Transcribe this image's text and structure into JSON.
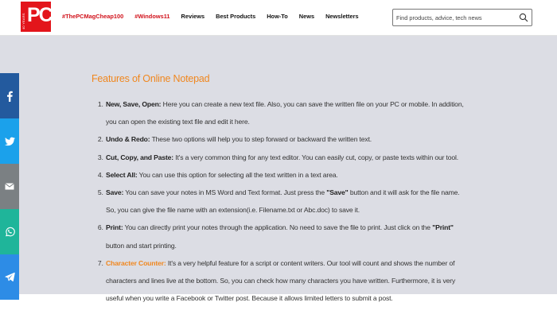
{
  "header": {
    "logo": {
      "years_text": "40 YEARS",
      "brand": "PC"
    },
    "nav": [
      {
        "label": "#ThePCMagCheap100",
        "tag": true
      },
      {
        "label": "#Windows11",
        "tag": true
      },
      {
        "label": "Reviews",
        "tag": false
      },
      {
        "label": "Best Products",
        "tag": false
      },
      {
        "label": "How-To",
        "tag": false
      },
      {
        "label": "News",
        "tag": false
      },
      {
        "label": "Newsletters",
        "tag": false
      }
    ],
    "search": {
      "placeholder": "Find products, advice, tech news",
      "icon": "search-icon"
    }
  },
  "article": {
    "heading": "Features of Online Notepad",
    "items": [
      {
        "title": "New, Save, Open:",
        "text": " Here you can create a new text file. Also, you can save the written file on your PC or mobile. In addition, you can open the existing text file and edit it here."
      },
      {
        "title": "Undo & Redo:",
        "text": " These two options will help you to step forward or backward the written text."
      },
      {
        "title": "Cut, Copy, and Paste:",
        "text": " It's a very common thing for any text editor. You can easily cut, copy, or paste texts within our tool."
      },
      {
        "title": "Select All:",
        "text": " You can use this option for selecting all the text written in a text area."
      },
      {
        "title": "Save:",
        "p1": " You can save your notes in MS Word and Text format. Just press the ",
        "q1": "\"Save\"",
        "p2": " button and it will ask for the file name. So, you can give the file name with an extension(i.e. Filename.txt or Abc.doc) to save it."
      },
      {
        "title": "Print:",
        "p1": " You can directly print your notes through the application. No need to save the file to print. Just click on the ",
        "q1": "\"Print\"",
        "p2": " button and start printing."
      },
      {
        "title": "Character Counter:",
        "text": " It's a very helpful feature for a script or content writers. Our tool will count and shows the number of characters and lines live at the bottom. So, you can check how many characters you have written. Furthermore, it is very useful when you write a Facebook or Twitter post. Because it allows limited letters to submit a post."
      }
    ]
  },
  "share": [
    {
      "icon": "facebook-icon",
      "color": "#235a9e"
    },
    {
      "icon": "twitter-icon",
      "color": "#1ba1eb"
    },
    {
      "icon": "email-icon",
      "color": "#7b8083"
    },
    {
      "icon": "whatsapp-icon",
      "color": "#1fb59a"
    },
    {
      "icon": "telegram-icon",
      "color": "#2d8ce6"
    }
  ],
  "colors": {
    "brand": "#e3151b",
    "accent": "#f0871f",
    "background": "#dcdde4"
  }
}
